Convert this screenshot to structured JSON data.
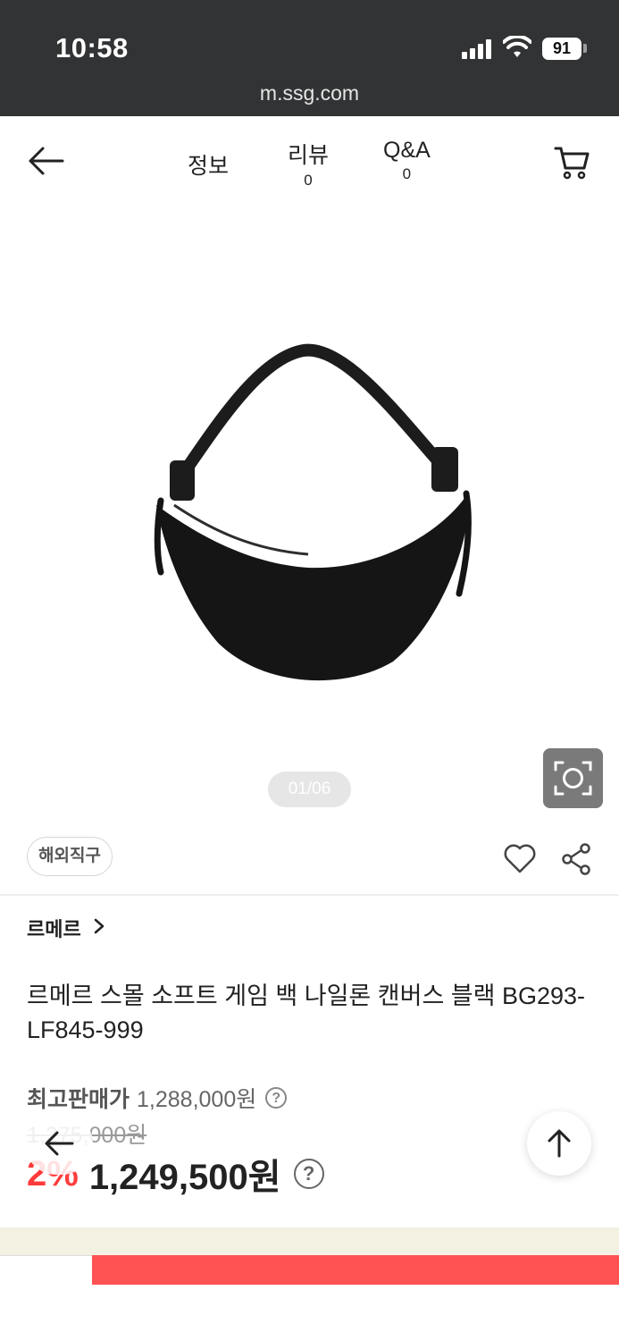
{
  "status_bar": {
    "time": "10:58",
    "battery": "91",
    "url": "m.ssg.com"
  },
  "nav": {
    "tabs": [
      {
        "label": "정보",
        "count": ""
      },
      {
        "label": "리뷰",
        "count": "0"
      },
      {
        "label": "Q&A",
        "count": "0"
      }
    ]
  },
  "gallery": {
    "pager": "01/06"
  },
  "product": {
    "badge": "해외직구",
    "brand": "르메르",
    "title": "르메르 스몰 소프트 게임 백 나일론 캔버스 블랙 BG293-LF845-999",
    "max_price_label": "최고판매가",
    "max_price": "1,288,000원",
    "original_price": "1,275,000원",
    "discount": "2%",
    "price": "1,249,500원"
  },
  "colors": {
    "status_bg": "#323334",
    "discount_red": "#ff3b3b",
    "buy_bar": "#ff5252"
  },
  "icons": [
    "back-arrow-icon",
    "cart-icon",
    "camera-search-icon",
    "heart-icon",
    "share-icon",
    "chevron-right-icon",
    "help-icon",
    "scroll-top-icon"
  ]
}
